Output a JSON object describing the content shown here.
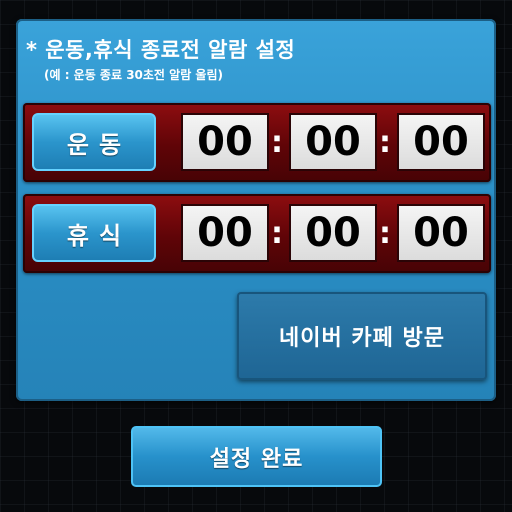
{
  "header": {
    "title": "* 운동,휴식 종료전 알람 설정",
    "subtitle": "(예 : 운동 종료 30초전 알람 울림)"
  },
  "exercise": {
    "label": "운동",
    "hours": "00",
    "minutes": "00",
    "seconds": "00",
    "separator": ":"
  },
  "rest": {
    "label": "휴식",
    "hours": "00",
    "minutes": "00",
    "seconds": "00",
    "separator": ":"
  },
  "buttons": {
    "cafe_label": "네이버 카페 방문",
    "done_label": "설정 완료"
  },
  "colors": {
    "panel": "#2b8fc6",
    "timer_row": "#5f0407",
    "digit_bg": "#dcdcdc",
    "background": "#07090c"
  }
}
